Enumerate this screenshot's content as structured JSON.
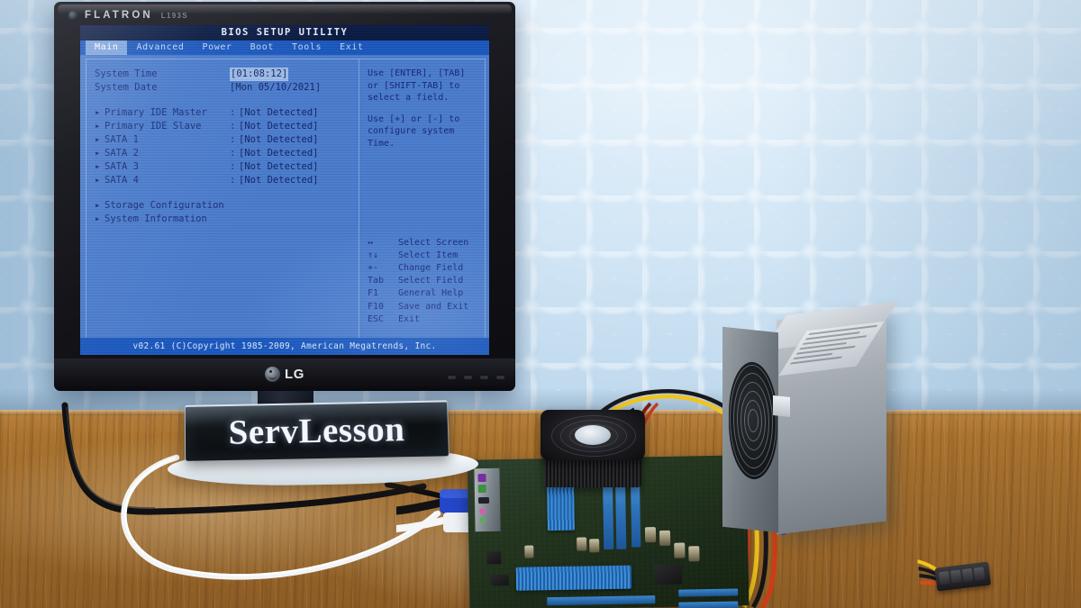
{
  "scene": {
    "description": "Photo of an LG FLATRON monitor displaying the AMI BIOS Setup Utility Main page, on a wooden desk with an open test-bench motherboard, an ATX power supply and a ServLesson light sign, against pale blue damask wallpaper",
    "colors": {
      "wall": "#cfe4f4",
      "desk": "#a9732f",
      "bios_background": "#4a7ccd",
      "bios_titlebar": "#0b1d49",
      "bios_menubar": "#1a58bf",
      "bios_text": "#16287a",
      "bios_selection": "#7fa5e0",
      "monitor_bezel": "#15151a",
      "psu_metal": "#a6adb3",
      "motherboard_pcb": "#24361f",
      "dimm_blue": "#2f74bb"
    }
  },
  "monitor": {
    "brand": "FLATRON",
    "model": "L193S",
    "bottom_logo": "LG"
  },
  "bios": {
    "title": "BIOS SETUP UTILITY",
    "menu": [
      {
        "label": "Main",
        "active": true
      },
      {
        "label": "Advanced",
        "active": false
      },
      {
        "label": "Power",
        "active": false
      },
      {
        "label": "Boot",
        "active": false
      },
      {
        "label": "Tools",
        "active": false
      },
      {
        "label": "Exit",
        "active": false
      }
    ],
    "clock_rows": [
      {
        "label": "System Time",
        "value": "[01:08:12]",
        "highlighted": true
      },
      {
        "label": "System Date",
        "value": "[Mon 05/10/2021]",
        "highlighted": false
      }
    ],
    "drive_rows": [
      {
        "label": "Primary IDE Master",
        "colon": ":",
        "value": "[Not Detected]"
      },
      {
        "label": "Primary IDE Slave",
        "colon": ":",
        "value": "[Not Detected]"
      },
      {
        "label": "SATA 1",
        "colon": ":",
        "value": "[Not Detected]"
      },
      {
        "label": "SATA 2",
        "colon": ":",
        "value": "[Not Detected]"
      },
      {
        "label": "SATA 3",
        "colon": ":",
        "value": "[Not Detected]"
      },
      {
        "label": "SATA 4",
        "colon": ":",
        "value": "[Not Detected]"
      }
    ],
    "submenus": [
      {
        "label": "Storage Configuration"
      },
      {
        "label": "System Information"
      }
    ],
    "help": {
      "paragraph1": "Use [ENTER], [TAB]\nor [SHIFT-TAB] to\nselect a field.",
      "paragraph2": "Use [+] or [-] to\nconfigure system Time."
    },
    "keys": [
      {
        "key": "↔",
        "action": "Select Screen"
      },
      {
        "key": "↑↓",
        "action": "Select Item"
      },
      {
        "key": "+-",
        "action": "Change Field"
      },
      {
        "key": "Tab",
        "action": "Select Field"
      },
      {
        "key": "F1",
        "action": "General Help"
      },
      {
        "key": "F10",
        "action": "Save and Exit"
      },
      {
        "key": "ESC",
        "action": "Exit"
      }
    ],
    "footer": "v02.61 (C)Copyright 1985-2009, American Megatrends, Inc.",
    "arrow_glyph": "▸"
  },
  "sign": {
    "text": "ServLesson"
  },
  "hardware": {
    "motherboard": "test-bench motherboard with CPU cooler, blue DIMM slots and heatsinks",
    "psu": "silver ATX power supply with circular fan grille and multicolored cable bundle",
    "molex": "4-pin Molex power connector"
  }
}
